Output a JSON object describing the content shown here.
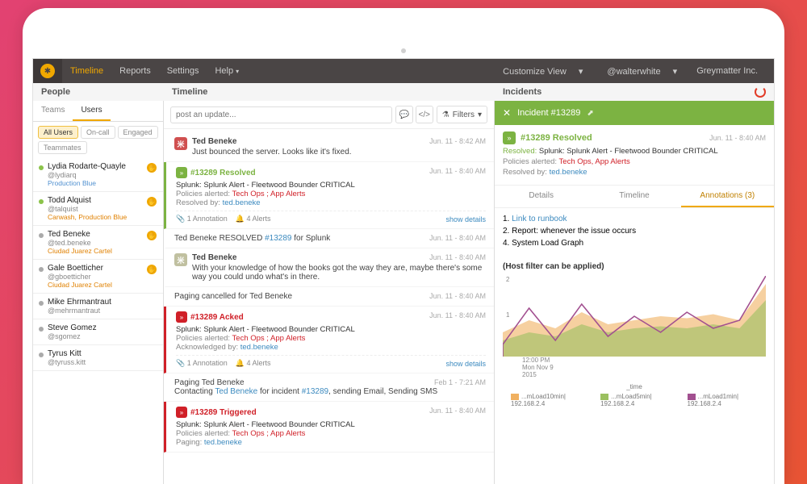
{
  "nav": {
    "items": [
      "Timeline",
      "Reports",
      "Settings",
      "Help"
    ],
    "active": 0
  },
  "topRight": {
    "customize": "Customize View",
    "user": "@walterwhite",
    "org": "Greymatter Inc."
  },
  "sections": {
    "people": "People",
    "timeline": "Timeline",
    "incidents": "Incidents"
  },
  "people": {
    "tabs": [
      "Teams",
      "Users"
    ],
    "activeTab": 1,
    "chips": [
      "All Users",
      "On-call",
      "Engaged",
      "Teammates"
    ],
    "activeChip": 0,
    "users": [
      {
        "name": "Lydia Rodarte-Quayle",
        "handle": "@lydiarq",
        "team": "Production Blue",
        "teamColor": "blue",
        "online": true,
        "hand": true
      },
      {
        "name": "Todd Alquist",
        "handle": "@talquist",
        "team": "Carwash, Production Blue",
        "teamColor": "orange",
        "online": true,
        "hand": true
      },
      {
        "name": "Ted Beneke",
        "handle": "@ted.beneke",
        "team": "Ciudad Juarez Cartel",
        "teamColor": "orange",
        "online": false,
        "hand": true
      },
      {
        "name": "Gale Boetticher",
        "handle": "@gboetticher",
        "team": "Ciudad Juarez Cartel",
        "teamColor": "orange",
        "online": false,
        "hand": true
      },
      {
        "name": "Mike Ehrmantraut",
        "handle": "@mehrmantraut",
        "team": "",
        "teamColor": "",
        "online": false,
        "hand": false
      },
      {
        "name": "Steve Gomez",
        "handle": "@sgomez",
        "team": "",
        "teamColor": "",
        "online": false,
        "hand": false
      },
      {
        "name": "Tyrus Kitt",
        "handle": "@tyruss.kitt",
        "team": "",
        "teamColor": "",
        "online": false,
        "hand": false
      }
    ]
  },
  "updateBox": {
    "placeholder": "post an update...",
    "filtersLabel": "Filters"
  },
  "timeline": [
    {
      "type": "msg",
      "avatar": "red",
      "name": "Ted Beneke",
      "text": "Just bounced the server. Looks like it's fixed.",
      "time": "Jun. 11 - 8:42 AM"
    },
    {
      "type": "incident",
      "state": "Resolved",
      "stateColor": "green",
      "num": "#13289",
      "alert": "Splunk: Splunk Alert - Fleetwood Bounder CRITICAL",
      "policies": "Tech Ops ; App Alerts",
      "resolvedBy": "ted.beneke",
      "annotations": "1 Annotation",
      "alerts": "4 Alerts",
      "show": "show details",
      "time": "Jun. 11 - 8:40 AM"
    },
    {
      "type": "line",
      "text_pre": "Ted Beneke RESOLVED ",
      "link": "#13289",
      "text_post": " for Splunk",
      "time": "Jun. 11 - 8:40 AM"
    },
    {
      "type": "msg",
      "avatar": "grey",
      "name": "Ted Beneke",
      "text": "With your knowledge of how the books got the way they are, maybe there's some way you could undo what's in there.",
      "time": "Jun. 11 - 8:40 AM"
    },
    {
      "type": "line",
      "text_pre": "Paging cancelled for Ted Beneke",
      "link": "",
      "text_post": "",
      "time": "Jun. 11 - 8:40 AM"
    },
    {
      "type": "incident",
      "state": "Acked",
      "stateColor": "red",
      "num": "#13289",
      "alert": "Splunk: Splunk Alert - Fleetwood Bounder CRITICAL",
      "policies": "Tech Ops ; App Alerts",
      "ackedBy": "ted.beneke",
      "ackLabel": "Acknowledged by:",
      "annotations": "1 Annotation",
      "alerts": "4 Alerts",
      "show": "show details",
      "time": "Jun. 11 - 8:40 AM"
    },
    {
      "type": "lineMulti",
      "pre": "Paging Ted Beneke",
      "body_pre": "Contacting ",
      "who": "Ted Beneke",
      "mid": " for incident ",
      "link": "#13289",
      "post": ", sending Email, Sending SMS",
      "time": "Feb 1 - 7:21 AM"
    },
    {
      "type": "incident",
      "state": "Triggered",
      "stateColor": "red",
      "num": "#13289",
      "alert": "Splunk: Splunk Alert - Fleetwood Bounder CRITICAL",
      "policies": "Tech Ops ; App Alerts",
      "pagedBy": "ted.beneke",
      "pagedLabel": "Paging:",
      "time": "Jun. 11 - 8:40 AM"
    }
  ],
  "incidentPanel": {
    "header": "Incident #13289",
    "boxTitle": "#13289 Resolved",
    "boxTime": "Jun. 11 - 8:40 AM",
    "line1_pre": "Resolved:",
    "line1": " Splunk: Splunk Alert - Fleetwood Bounder CRITICAL",
    "line2_lbl": "Policies alerted: ",
    "line2": "Tech Ops, App Alerts",
    "line3_lbl": "Resolved by:  ",
    "line3": "ted.beneke",
    "tabs": [
      "Details",
      "Timeline",
      "Annotations (3)"
    ],
    "activeTab": 2,
    "annotations": [
      {
        "n": "1.",
        "text": "Link to runbook",
        "isLink": true
      },
      {
        "n": "2.",
        "text": "Report: whenever the issue occurs",
        "isLink": false
      },
      {
        "n": "4.",
        "text": "System Load Graph",
        "isLink": false
      }
    ],
    "chartTitle": "(Host filter can be applied)",
    "chart_data": {
      "type": "area",
      "ylim": [
        0,
        2
      ],
      "yticks": [
        1,
        2
      ],
      "x_date": "Mon Nov 9",
      "x_year": "2015",
      "xticks": [
        "12:00 PM",
        "",
        "",
        "",
        ""
      ],
      "x_axis_label": "_time",
      "series": [
        {
          "name": "...mLoad10min| 192.168.2.4",
          "color": "#f0b060",
          "values": [
            0.6,
            0.9,
            0.7,
            1.1,
            0.8,
            0.9,
            1.0,
            0.95,
            1.05,
            0.9,
            1.8
          ]
        },
        {
          "name": "...mLoad5min| 192.168.2.4",
          "color": "#9bc060",
          "values": [
            0.4,
            0.6,
            0.5,
            0.8,
            0.6,
            0.7,
            0.75,
            0.7,
            0.8,
            0.7,
            1.4
          ]
        },
        {
          "name": "...mLoad1min| 192.168.2.4",
          "color": "#a25090",
          "values": [
            0.3,
            1.2,
            0.4,
            1.3,
            0.5,
            1.0,
            0.6,
            1.1,
            0.7,
            0.9,
            2.0
          ]
        }
      ]
    }
  }
}
